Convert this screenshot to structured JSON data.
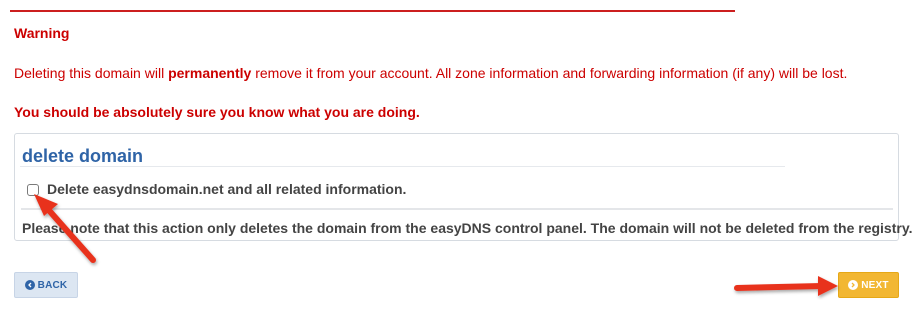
{
  "warning": {
    "title": "Warning",
    "text_before": "Deleting this domain will ",
    "text_bold": "permanently",
    "text_after": " remove it from your account. All zone information and forwarding information (if any) will be lost.",
    "emphasis": "You should be absolutely sure you know what you are doing."
  },
  "panel": {
    "title": "delete domain",
    "checkbox_label": "Delete easydnsdomain.net and all related information.",
    "checkbox_checked": false,
    "note": "Please note that this action only deletes the domain from the easyDNS control panel. The domain will not be deleted from the registry."
  },
  "buttons": {
    "back_label": "BACK",
    "back_icon": "chevron-left-circle-icon",
    "next_label": "NEXT",
    "next_icon": "chevron-right-circle-icon"
  },
  "colors": {
    "warning_red": "#cc0000",
    "title_blue": "#2f64a7",
    "next_yellow": "#f2b733",
    "annotation_arrow": "#e8321f"
  }
}
